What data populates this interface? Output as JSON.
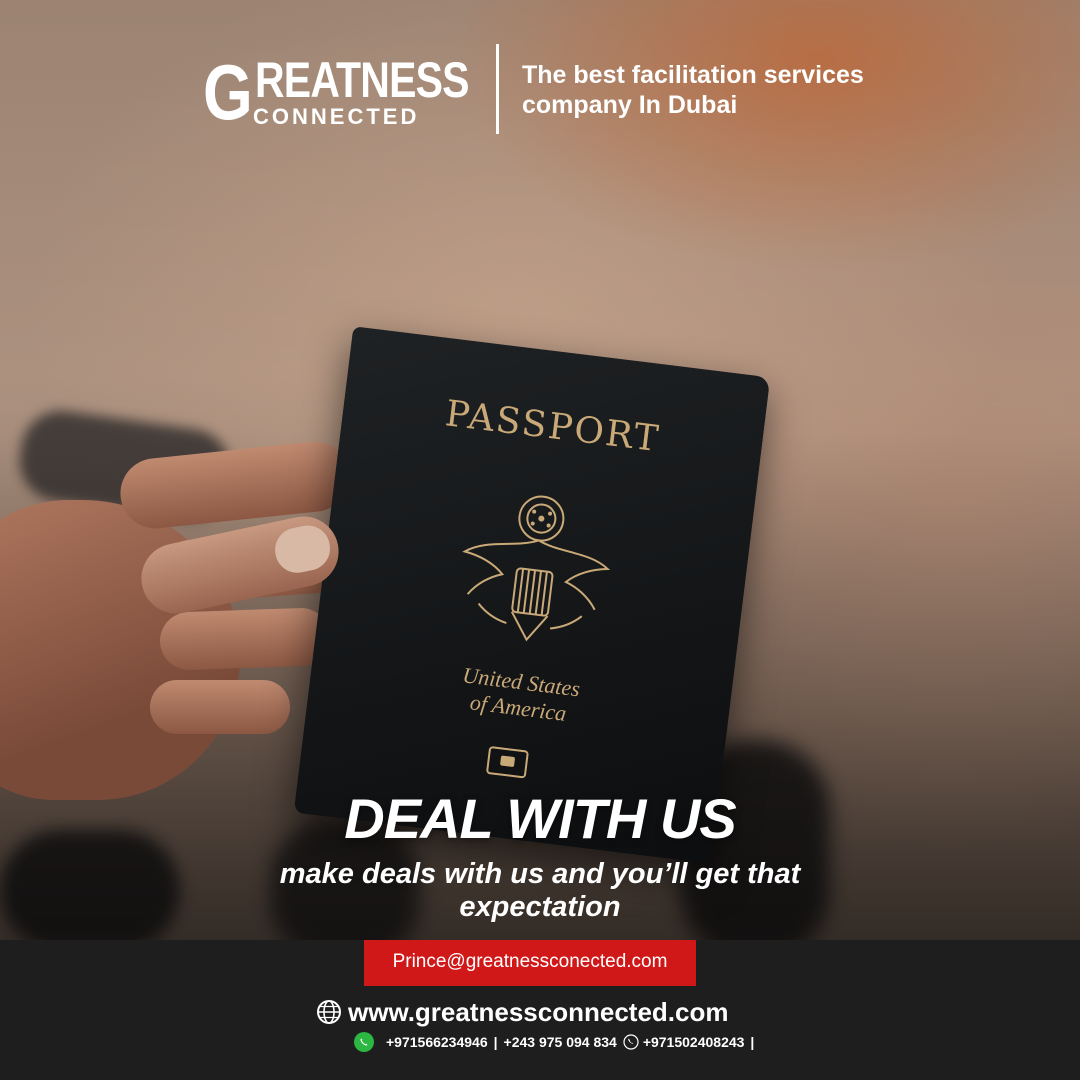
{
  "brand": {
    "logo_initial": "G",
    "logo_main": "REATNESS",
    "logo_sub": "CONNECTED",
    "tagline": "The best facilitation services company In Dubai"
  },
  "passport": {
    "title": "PASSPORT",
    "country_line1": "United States",
    "country_line2": "of America"
  },
  "hero": {
    "headline": "DEAL WITH US",
    "subline": "make deals with us and you’ll get that expectation"
  },
  "contact": {
    "email": "Prince@greatnessconected.com",
    "website": "www.greatnessconnected.com",
    "phone_whatsapp": "+971566234946",
    "phone_congo": "+243 975 094 834",
    "phone_uae": "+971502408243",
    "separator": "|"
  },
  "colors": {
    "email_bg": "#d01818",
    "footer_bg": "#1e1e1e",
    "passport_gold": "#c9a978",
    "whatsapp_green": "#2bb741"
  },
  "icons": [
    "globe-icon",
    "whatsapp-icon",
    "phone-icon"
  ]
}
